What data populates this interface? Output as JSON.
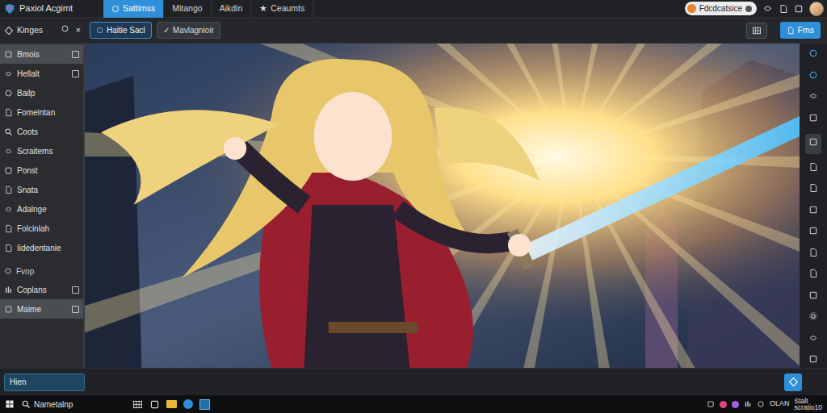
{
  "window": {
    "title": "Paxiol Acgimt"
  },
  "tabs": [
    {
      "label": "Sattimss",
      "selected": true
    },
    {
      "label": "Mitango",
      "selected": false
    },
    {
      "label": "Aikdin",
      "selected": false
    },
    {
      "label": "Ceaumts",
      "selected": false,
      "icon": "★"
    }
  ],
  "account": {
    "label": "Fdcdcatsice"
  },
  "panel": {
    "title": "Kinges",
    "close": "×"
  },
  "toolbar": {
    "chips": [
      {
        "label": "Haitie Sacl",
        "selected": true
      },
      {
        "label": "Mavlagnioir",
        "selected": false,
        "icon": "✓"
      }
    ],
    "button": "Fms"
  },
  "sidebar": {
    "items": [
      {
        "label": "Bmois",
        "kind": "check",
        "selected": true,
        "checked": false
      },
      {
        "label": "Hellalt",
        "kind": "check",
        "selected": false,
        "checked": false
      },
      {
        "label": "Bailp",
        "kind": "plain",
        "selected": false
      },
      {
        "label": "Fomeintan",
        "kind": "plain",
        "selected": false
      },
      {
        "label": "Coots",
        "kind": "plain",
        "selected": false
      },
      {
        "label": "Scraitems",
        "kind": "plain",
        "selected": false
      },
      {
        "label": "Ponst",
        "kind": "plain",
        "selected": false
      },
      {
        "label": "Snata",
        "kind": "plain",
        "selected": false
      },
      {
        "label": "Adalnge",
        "kind": "plain",
        "selected": false
      },
      {
        "label": "Folcinlah",
        "kind": "plain",
        "selected": false
      },
      {
        "label": "Iidedentanie",
        "kind": "plain",
        "selected": false
      }
    ],
    "section": "Fvop",
    "section_items": [
      {
        "label": "Coplans",
        "kind": "check",
        "selected": false,
        "checked": false
      },
      {
        "label": "Maime",
        "kind": "check",
        "selected": true,
        "checked": false
      }
    ]
  },
  "footer": {
    "button": "Hien"
  },
  "taskbar": {
    "search": "Nametalnp",
    "tray": "OLAN",
    "clock": [
      "Stalt",
      "scratio10"
    ]
  }
}
